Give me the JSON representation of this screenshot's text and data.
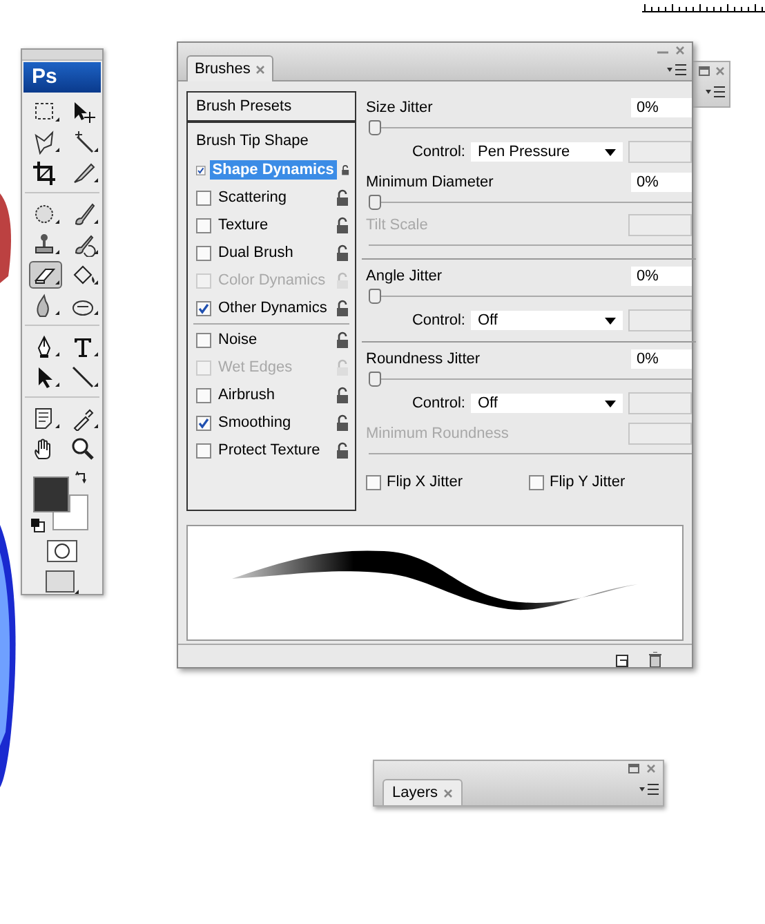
{
  "toolbox": {
    "logo": "Ps",
    "tool_groups": [
      [
        {
          "selected": false
        },
        {
          "selected": false
        },
        {
          "selected": false
        },
        {
          "selected": false
        },
        {
          "selected": false
        },
        {
          "selected": false
        }
      ],
      [
        {
          "selected": false
        },
        {
          "selected": false
        },
        {
          "selected": false
        },
        {
          "selected": false
        },
        {
          "selected": true
        },
        {
          "selected": false
        },
        {
          "selected": false
        },
        {
          "selected": false
        }
      ],
      [
        {
          "selected": false
        },
        {
          "selected": false
        },
        {
          "selected": false
        },
        {
          "selected": false
        }
      ],
      [
        {
          "selected": false
        },
        {
          "selected": false
        },
        {
          "selected": false
        },
        {
          "selected": false
        }
      ]
    ],
    "swatches": [
      {
        "color": "#333333"
      },
      {
        "color": "#ffffff"
      }
    ]
  },
  "brushes_panel": {
    "tab": "Brushes",
    "presets_button": "Brush Presets",
    "tip_shape": "Brush Tip Shape",
    "option_groups": [
      [
        {
          "label": "Shape Dynamics",
          "checked": true,
          "disabled": false,
          "selected": true
        },
        {
          "label": "Scattering",
          "checked": false,
          "disabled": false,
          "selected": false
        },
        {
          "label": "Texture",
          "checked": false,
          "disabled": false,
          "selected": false
        },
        {
          "label": "Dual Brush",
          "checked": false,
          "disabled": false,
          "selected": false
        },
        {
          "label": "Color Dynamics",
          "checked": false,
          "disabled": true,
          "selected": false
        },
        {
          "label": "Other Dynamics",
          "checked": true,
          "disabled": false,
          "selected": false
        }
      ],
      [
        {
          "label": "Noise",
          "checked": false,
          "disabled": false,
          "selected": false
        },
        {
          "label": "Wet Edges",
          "checked": false,
          "disabled": true,
          "selected": false
        },
        {
          "label": "Airbrush",
          "checked": false,
          "disabled": false,
          "selected": false
        },
        {
          "label": "Smoothing",
          "checked": true,
          "disabled": false,
          "selected": false
        },
        {
          "label": "Protect Texture",
          "checked": false,
          "disabled": false,
          "selected": false
        }
      ]
    ],
    "settings": [
      [
        {
          "kind": "slider",
          "label": "Size Jitter",
          "value": "0%",
          "level": 0,
          "disabled": false
        },
        {
          "kind": "control",
          "label": "Control:",
          "value": "Pen Pressure"
        },
        {
          "kind": "slider",
          "label": "Minimum Diameter",
          "value": "0%",
          "level": 0,
          "disabled": false
        },
        {
          "kind": "slider",
          "label": "Tilt Scale",
          "disabled": true
        }
      ],
      [
        {
          "kind": "slider",
          "label": "Angle Jitter",
          "value": "0%",
          "level": 0,
          "disabled": false
        },
        {
          "kind": "control",
          "label": "Control:",
          "value": "Off"
        }
      ],
      [
        {
          "kind": "slider",
          "label": "Roundness Jitter",
          "value": "0%",
          "level": 0,
          "disabled": false
        },
        {
          "kind": "control",
          "label": "Control:",
          "value": "Off"
        },
        {
          "kind": "slider",
          "label": "Minimum Roundness",
          "disabled": true
        }
      ]
    ],
    "flips": [
      {
        "label": "Flip X Jitter",
        "checked": false
      },
      {
        "label": "Flip Y Jitter",
        "checked": false
      }
    ]
  },
  "layers_panel": {
    "tab": "Layers"
  }
}
